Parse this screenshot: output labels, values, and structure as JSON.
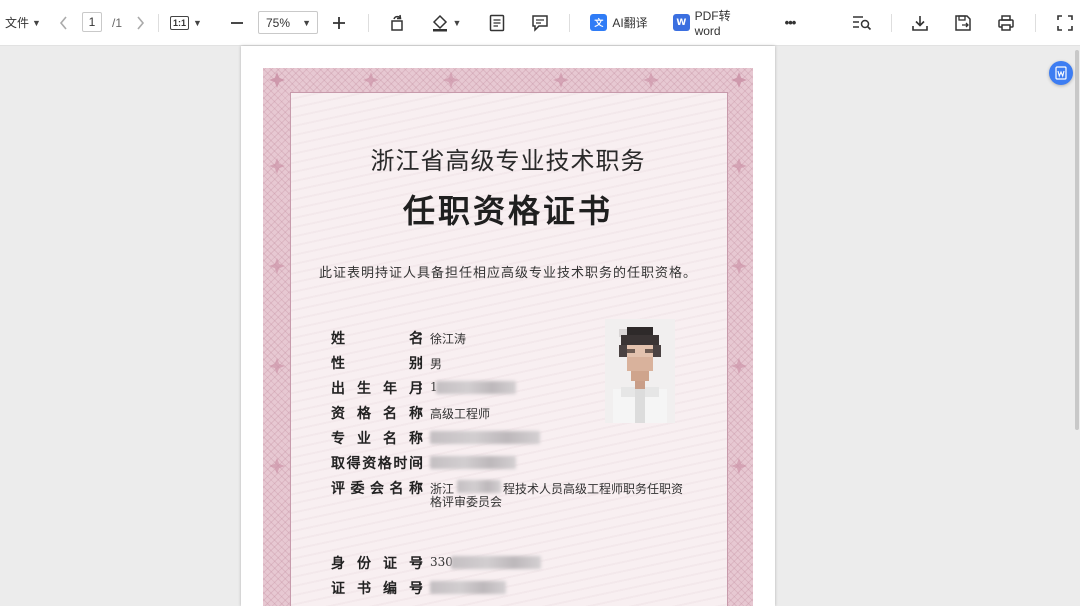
{
  "toolbar": {
    "file_label": "文件",
    "current_page": "1",
    "total_pages": "/1",
    "actual_size_label": "1:1",
    "zoom_level": "75%",
    "ai_translate_label": "AI翻译",
    "pdf_to_word_label": "PDF转word",
    "more_label": "•••",
    "ai_badge_color": "#2f7cf6",
    "word_badge_color": "#3b6fe0"
  },
  "certificate": {
    "title_line1": "浙江省高级专业技术职务",
    "title_line2": "任职资格证书",
    "statement": "此证表明持证人具备担任相应高级专业技术职务的任职资格。",
    "fields": [
      {
        "label": "姓名",
        "value": "徐江涛"
      },
      {
        "label": "性别",
        "value": "男"
      },
      {
        "label": "出生年月",
        "value": "1"
      },
      {
        "label": "资格名称",
        "value": "高级工程师"
      },
      {
        "label": "专业名称",
        "value": ""
      },
      {
        "label": "取得资格时间",
        "value": ""
      },
      {
        "label": "评委会名称",
        "value_line1": "浙江",
        "value_line1b": "程技术人员高级工程师职务任职资",
        "value_line2": "格评审委员会"
      },
      {
        "label": "身份证号",
        "value": "330"
      },
      {
        "label": "证书编号",
        "value": ""
      }
    ],
    "border_color": "#e7c8d2",
    "paper_color": "#f8eff1"
  }
}
